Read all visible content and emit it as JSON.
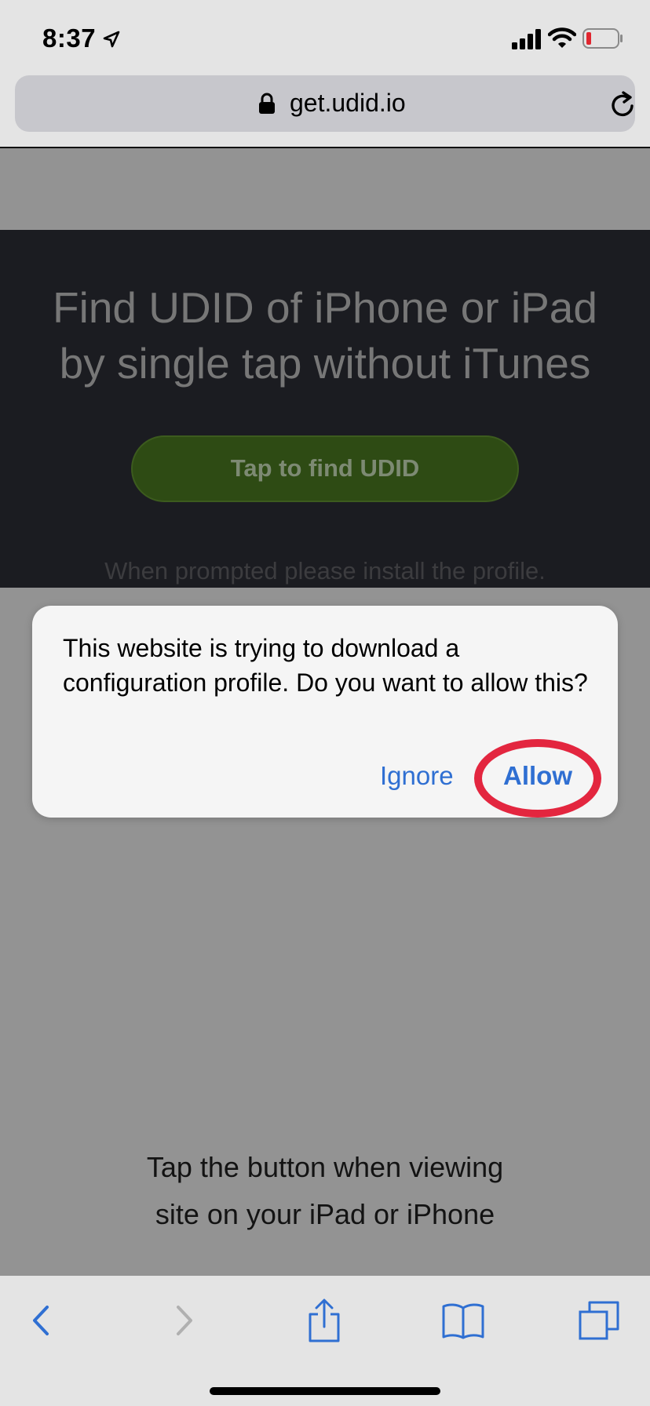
{
  "status_bar": {
    "time": "8:37"
  },
  "browser": {
    "url": "get.udid.io"
  },
  "page": {
    "hero_title_line1": "Find UDID of iPhone or iPad",
    "hero_title_line2": "by single tap without iTunes",
    "cta_label": "Tap to find UDID",
    "note": "When prompted please install the profile.",
    "bottom_line1": "Tap the button when viewing",
    "bottom_line2": "site on your iPad or iPhone"
  },
  "dialog": {
    "message": "This website is trying to download a configuration profile. Do you want to allow this?",
    "ignore_label": "Ignore",
    "allow_label": "Allow"
  },
  "colors": {
    "accent": "#2f6fd2",
    "highlight_ring": "#e3263f",
    "cta_green": "#2e4b14"
  }
}
